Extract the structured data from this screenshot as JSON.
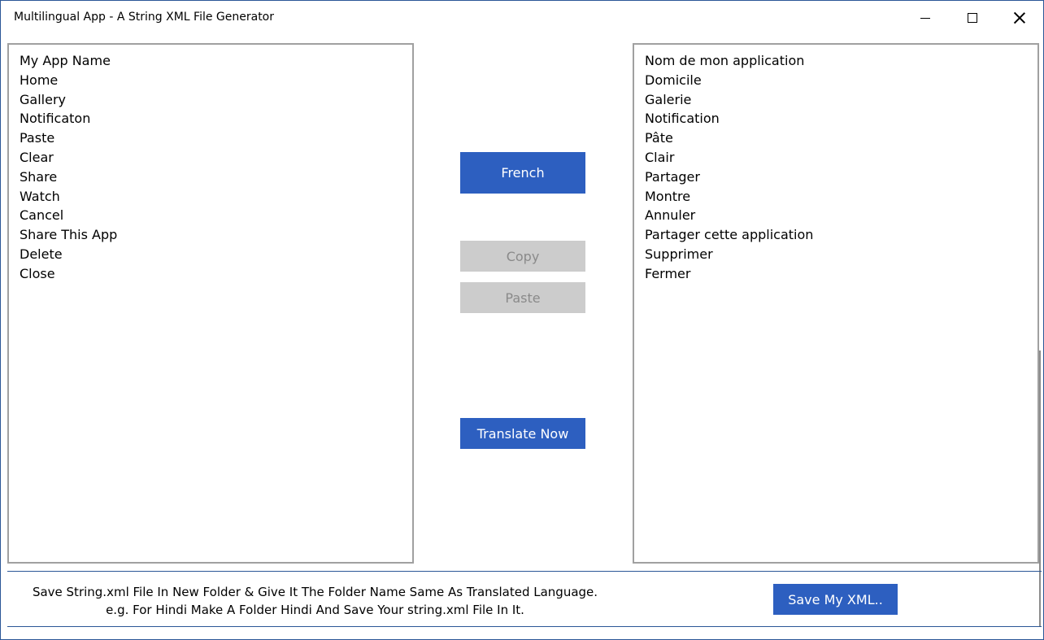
{
  "window": {
    "title": "Multilingual App - A String XML File Generator"
  },
  "source": {
    "lines": [
      "My App Name",
      "Home",
      "Gallery",
      "Notificaton",
      "Paste",
      "Clear",
      "Share",
      "Watch",
      "Cancel",
      "Share This App",
      "Delete",
      "Close"
    ]
  },
  "target": {
    "lines": [
      "Nom de mon application",
      "Domicile",
      "Galerie",
      "Notification",
      "Pâte",
      "Clair",
      "Partager",
      "Montre",
      "Annuler",
      "Partager cette application",
      "Supprimer",
      "Fermer"
    ]
  },
  "controls": {
    "language_label": "French",
    "copy_label": "Copy",
    "paste_label": "Paste",
    "translate_label": "Translate Now",
    "save_label": "Save My XML.."
  },
  "footer": {
    "line1": "Save String.xml File In New Folder & Give It The Folder Name Same As Translated Language.",
    "line2": "e.g. For Hindi Make A Folder Hindi And Save Your string.xml File In It."
  },
  "colors": {
    "accent": "#2d5fc0",
    "disabled_bg": "#cccccc",
    "disabled_text": "#8a8a8a",
    "border": "#2b5797"
  },
  "icons": {
    "minimize": "minimize-icon",
    "maximize": "maximize-icon",
    "close": "close-icon"
  }
}
